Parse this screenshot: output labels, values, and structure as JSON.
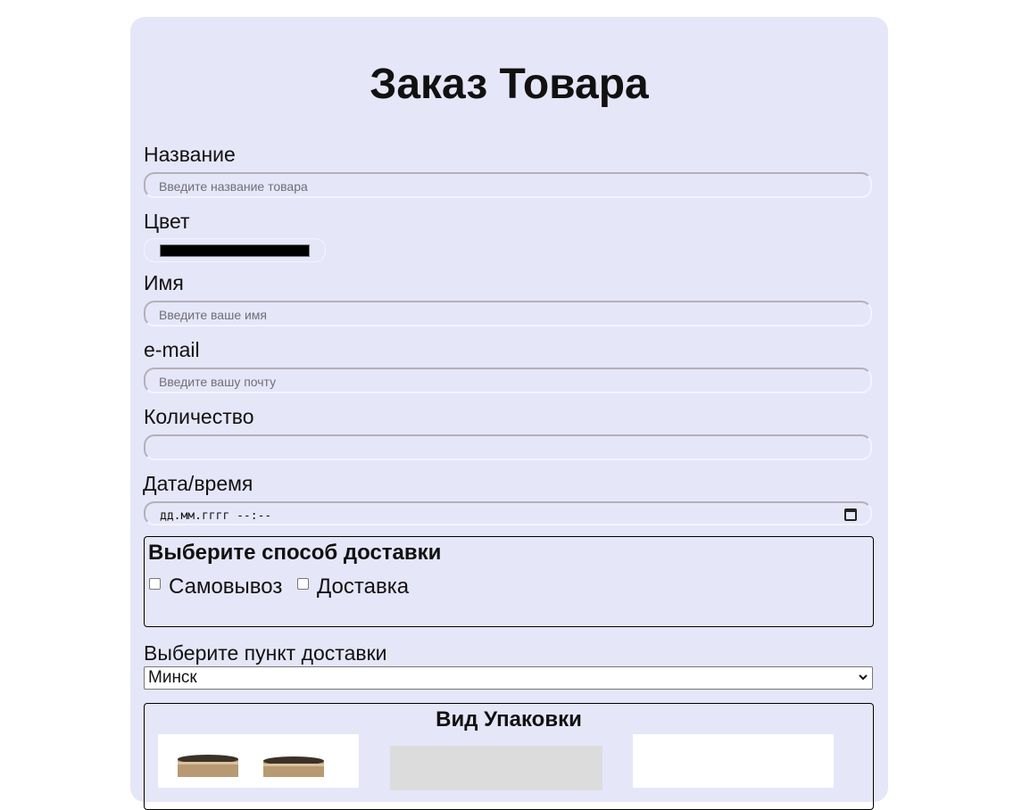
{
  "form": {
    "title": "Заказ Товара",
    "fields": {
      "name": {
        "label": "Название",
        "placeholder": "Введите название товара"
      },
      "color": {
        "label": "Цвет",
        "value": "#000000"
      },
      "person": {
        "label": "Имя",
        "placeholder": "Введите ваше имя"
      },
      "email": {
        "label": "e-mail",
        "placeholder": "Введите вашу почту"
      },
      "quantity": {
        "label": "Количество",
        "value": ""
      },
      "datetime": {
        "label": "Дата/время",
        "placeholder": "дд.мм.гггг --:--"
      }
    },
    "delivery": {
      "legend": "Выберите способ доставки",
      "options": [
        {
          "label": "Самовывоз",
          "checked": false
        },
        {
          "label": "Доставка",
          "checked": false
        }
      ]
    },
    "pickup_point": {
      "label": "Выберите пункт доставки",
      "selected": "Минск"
    },
    "packaging": {
      "title": "Вид Упаковки",
      "images": [
        "packaging-option-1-image",
        "packaging-option-2-image",
        "packaging-option-3-image"
      ]
    }
  },
  "colors": {
    "card_background": "#e6e6f9",
    "page_background": "#ffffff"
  }
}
